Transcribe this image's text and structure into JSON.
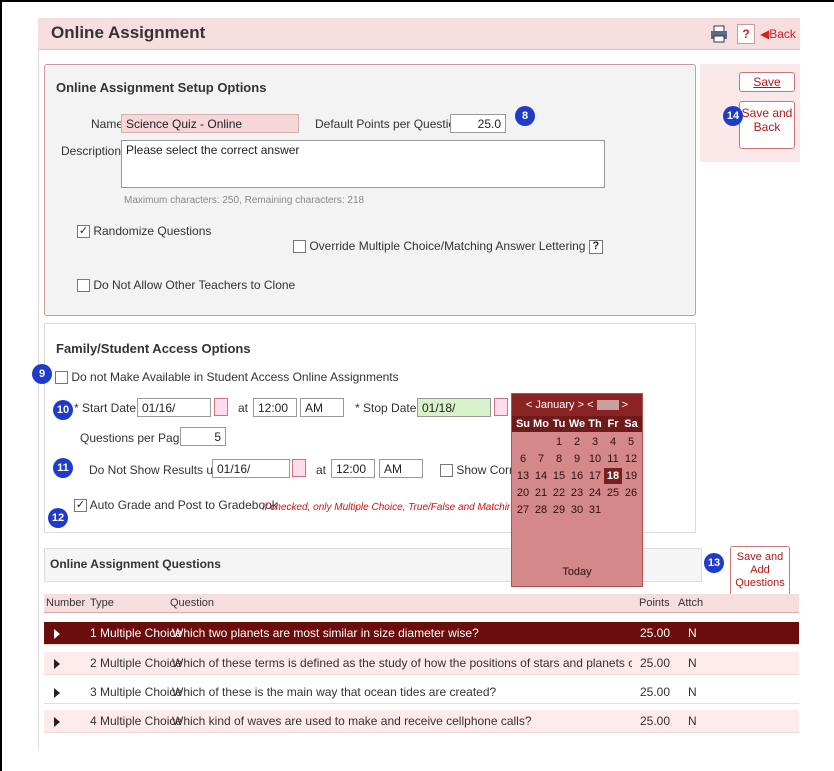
{
  "header": {
    "title": "Online Assignment",
    "help": "?",
    "back": "Back"
  },
  "setup": {
    "title": "Online Assignment Setup Options",
    "name_label": "Name:",
    "name_value": "Science Quiz - Online",
    "points_label": "Default Points per Question:",
    "points_value": "25.0",
    "desc_label": "Description:",
    "desc_value": "Please select the correct answer",
    "chars_hint": "Maximum characters: 250, Remaining characters: 218",
    "randomize_label": "Randomize Questions",
    "randomize_checked": "✓",
    "override_label": "Override Multiple Choice/Matching Answer Lettering",
    "override_help": "?",
    "clone_label": "Do Not Allow Other Teachers to Clone"
  },
  "actions": {
    "save": "Save",
    "save_back": "Save and\nBack",
    "save_add": "Save and\nAdd\nQuestions"
  },
  "badges": {
    "b8": "8",
    "b9": "9",
    "b10": "10",
    "b11": "11",
    "b12": "12",
    "b13": "13",
    "b14": "14"
  },
  "access": {
    "title": "Family/Student Access Options",
    "not_available_label": "Do not Make Available in Student Access Online Assignments",
    "start_label": "* Start Date:",
    "start_value": "01/16/",
    "at": "at",
    "start_time": "12:00",
    "start_ampm": "AM",
    "stop_label": "* Stop Date:",
    "stop_value": "01/18/",
    "qpp_label": "Questions per Page:",
    "qpp_value": "5",
    "results_label": "Do Not Show Results until:",
    "results_value": "01/16/",
    "results_time": "12:00",
    "results_ampm": "AM",
    "show_correct_label": "Show Correc",
    "auto_grade_label": "Auto Grade and Post to Gradebook",
    "auto_grade_checked": "✓",
    "auto_grade_note": "If checked, only Multiple Choice, True/False and Matching questio"
  },
  "calendar": {
    "month": "January",
    "dow": [
      "Su",
      "Mo",
      "Tu",
      "We",
      "Th",
      "Fr",
      "Sa"
    ],
    "weeks": [
      [
        "",
        "",
        "",
        "1",
        "2",
        "3",
        "4",
        "5"
      ],
      [
        "6",
        "7",
        "8",
        "9",
        "10",
        "11",
        "12"
      ],
      [
        "13",
        "14",
        "15",
        "16",
        "17",
        "18",
        "19"
      ],
      [
        "20",
        "21",
        "22",
        "23",
        "24",
        "25",
        "26"
      ],
      [
        "27",
        "28",
        "29",
        "30",
        "31",
        "",
        ""
      ]
    ],
    "selected": "18",
    "today": "Today"
  },
  "questions": {
    "title": "Online Assignment Questions",
    "columns": {
      "number": "Number",
      "type": "Type",
      "question": "Question",
      "points": "Points",
      "attach": "Attch"
    },
    "rows": [
      {
        "n": "1",
        "type": "Multiple Choice",
        "q": "Which two planets are most similar in size diameter wise?",
        "points": "25.00",
        "attach": "N"
      },
      {
        "n": "2",
        "type": "Multiple Choice",
        "q": "Which of these terms is defined as the study of how the positions of stars and planets can influenc",
        "points": "25.00",
        "attach": "N"
      },
      {
        "n": "3",
        "type": "Multiple Choice",
        "q": "Which of these is the main way that ocean tides are created?",
        "points": "25.00",
        "attach": "N"
      },
      {
        "n": "4",
        "type": "Multiple Choice",
        "q": "Which kind of waves are used to make and receive cellphone calls?",
        "points": "25.00",
        "attach": "N"
      }
    ]
  }
}
